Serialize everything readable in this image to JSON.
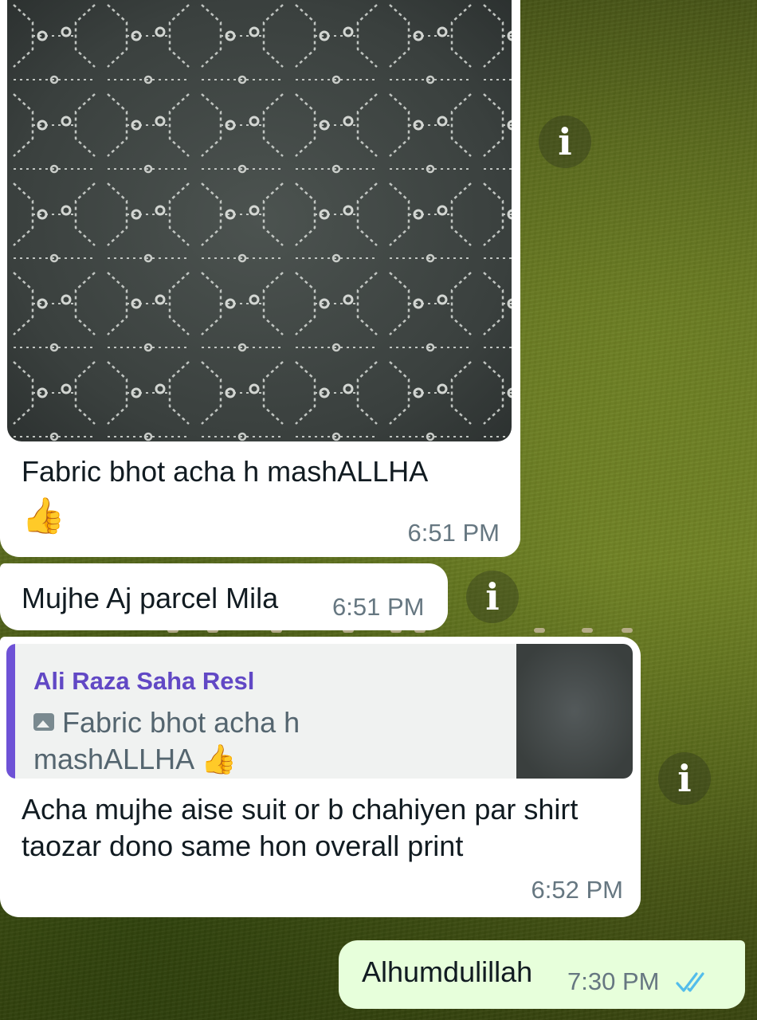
{
  "messages": [
    {
      "direction": "incoming",
      "type": "image",
      "caption": "Fabric bhot acha h mashALLHA",
      "emoji": "👍",
      "time": "6:51 PM"
    },
    {
      "direction": "incoming",
      "type": "text",
      "text": "Mujhe Aj parcel Mila",
      "time": "6:51 PM"
    },
    {
      "direction": "incoming",
      "type": "reply",
      "quoted_author": "Ali Raza Saha Resl",
      "quoted_text": "Fabric bhot acha h mashALLHA 👍",
      "text": "Acha mujhe aise suit or b chahiyen par shirt taozar dono same hon overall print",
      "time": "6:52 PM"
    },
    {
      "direction": "outgoing",
      "type": "text",
      "text": "Alhumdulillah",
      "time": "7:30 PM",
      "status": "read"
    }
  ],
  "icons": {
    "info": "i",
    "quoted_media": "image-icon",
    "read_receipt": "double-check-icon"
  },
  "colors": {
    "incoming_bubble": "#ffffff",
    "outgoing_bubble": "#e7ffdb",
    "quote_accent": "#6e52d6",
    "read_ticks": "#53bdeb"
  }
}
